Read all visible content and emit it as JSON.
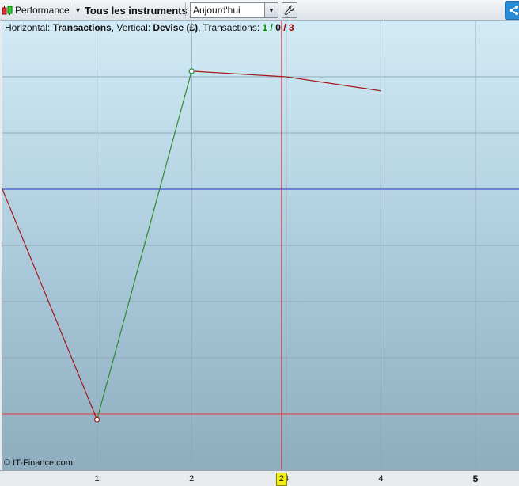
{
  "toolbar": {
    "performance_label": "Performance",
    "instruments_label": "Tous les instruments",
    "period_value": "Aujourd'hui"
  },
  "info_bar": {
    "horizontal_label": "Horizontal: ",
    "horizontal_value": "Transactions",
    "vertical_label": ", Vertical: ",
    "vertical_value": "Devise (£)",
    "transactions_label": ", Transactions: ",
    "win_count": "1",
    "neutral_count": "0",
    "loss_count": "3",
    "sep1": " / ",
    "sep2": " / "
  },
  "copyright": "© IT-Finance.com",
  "crosshair_label": "2",
  "colors": {
    "up": "#2e8b2e",
    "down": "#a31a1a",
    "zero_line": "#2233cc",
    "crosshair": "#e23a3a",
    "grid": "#8fa8b8"
  },
  "chart_data": {
    "type": "line",
    "x_ticks": [
      {
        "x": 1,
        "label": "1"
      },
      {
        "x": 2,
        "label": "2"
      },
      {
        "x": 3,
        "label": "3"
      },
      {
        "x": 4,
        "label": "4"
      },
      {
        "x": 5,
        "label": "5"
      }
    ],
    "xlim": [
      0,
      5.46
    ],
    "ylim": [
      -1.0,
      0.6
    ],
    "zero_y": 0,
    "grid_y": [
      -1.0,
      -0.8,
      -0.6,
      -0.4,
      -0.2,
      0,
      0.2,
      0.4,
      0.6
    ],
    "crosshair": {
      "x": 2.95,
      "y": -0.8
    },
    "segments": [
      {
        "x1": 0,
        "y1": 0,
        "x2": 1,
        "y2": -0.82,
        "color": "down"
      },
      {
        "x1": 1,
        "y1": -0.82,
        "x2": 2,
        "y2": 0.42,
        "color": "up"
      },
      {
        "x1": 2,
        "y1": 0.42,
        "x2": 3,
        "y2": 0.4,
        "color": "down"
      },
      {
        "x1": 3,
        "y1": 0.4,
        "x2": 4,
        "y2": 0.35,
        "color": "down"
      }
    ],
    "markers": [
      {
        "x": 1,
        "y": -0.82,
        "color": "down"
      },
      {
        "x": 2,
        "y": 0.42,
        "color": "up"
      }
    ]
  }
}
